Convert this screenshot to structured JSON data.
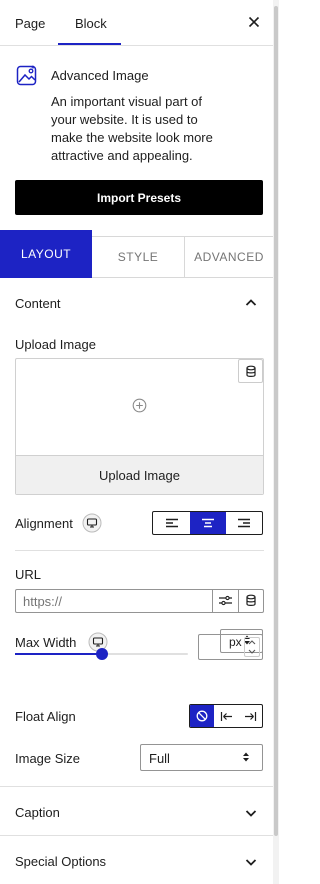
{
  "tabs": {
    "page": "Page",
    "block": "Block"
  },
  "block": {
    "title": "Advanced Image",
    "description_lines": [
      "An important visual part of",
      "your website. It is used to",
      "make the website look more",
      "attractive and appealing."
    ]
  },
  "presets": {
    "button": "Import Presets"
  },
  "panel_tabs": {
    "layout": "LAYOUT",
    "style": "STYLE",
    "advanced": "ADVANCED"
  },
  "content": {
    "heading": "Content",
    "upload_label": "Upload Image",
    "upload_button": "Upload Image",
    "alignment_label": "Alignment",
    "url_label": "URL",
    "url_placeholder": "https://",
    "max_width_label": "Max Width",
    "unit": "px",
    "max_width_slider_value": 0.5,
    "float_align_label": "Float Align",
    "image_size_label": "Image Size",
    "image_size_value": "Full"
  },
  "sections": {
    "caption": "Caption",
    "special": "Special Options"
  },
  "colors": {
    "accent": "#1d23c4",
    "primary_button": "#000000"
  }
}
